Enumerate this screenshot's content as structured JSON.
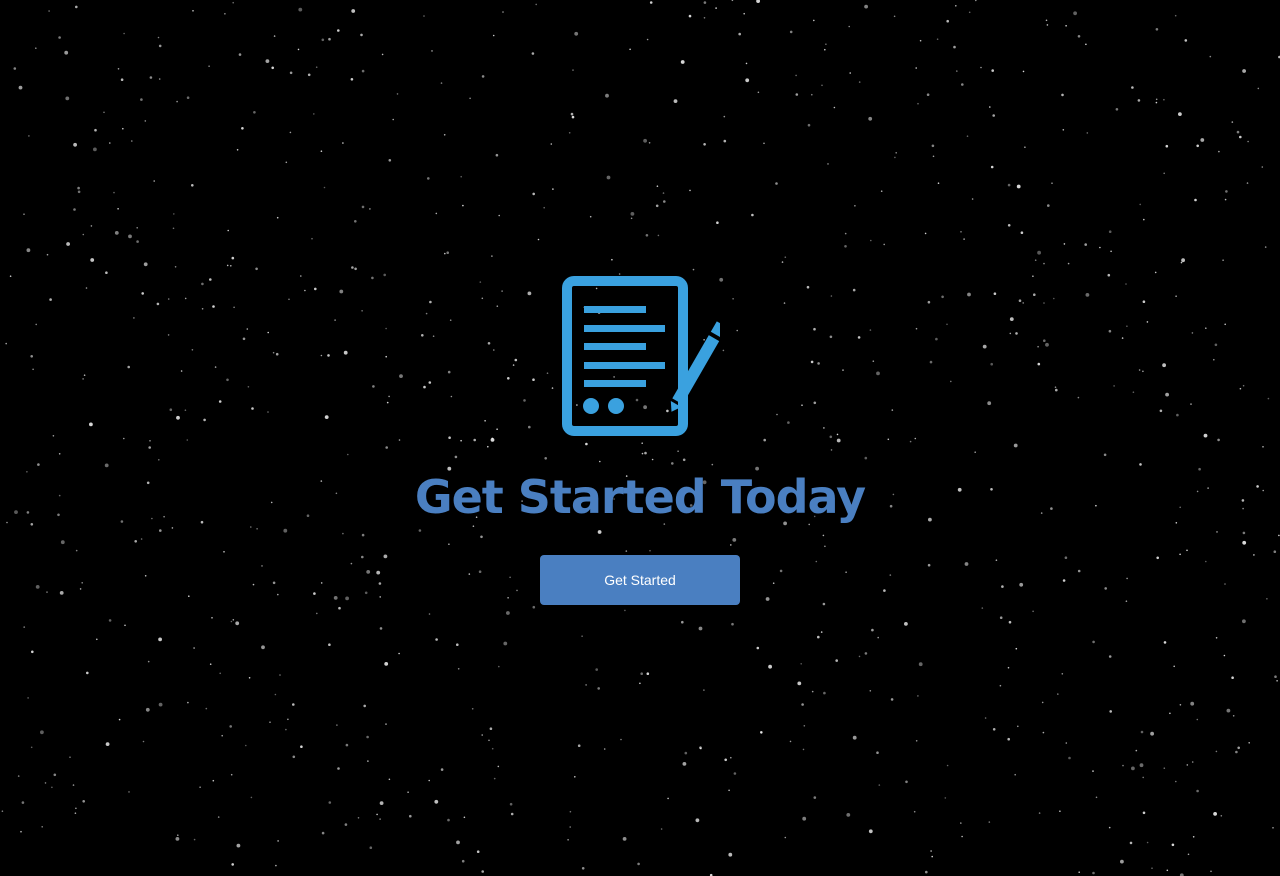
{
  "theme": {
    "background": "#000000",
    "accent": "#4a7fc1",
    "icon_color": "#3aa1df",
    "button_text_color": "#ffffff",
    "star_color": "#ffffff"
  },
  "hero": {
    "icon": "document-with-pencil-icon",
    "headline": "Get Started Today",
    "button_label": "Get Started"
  }
}
